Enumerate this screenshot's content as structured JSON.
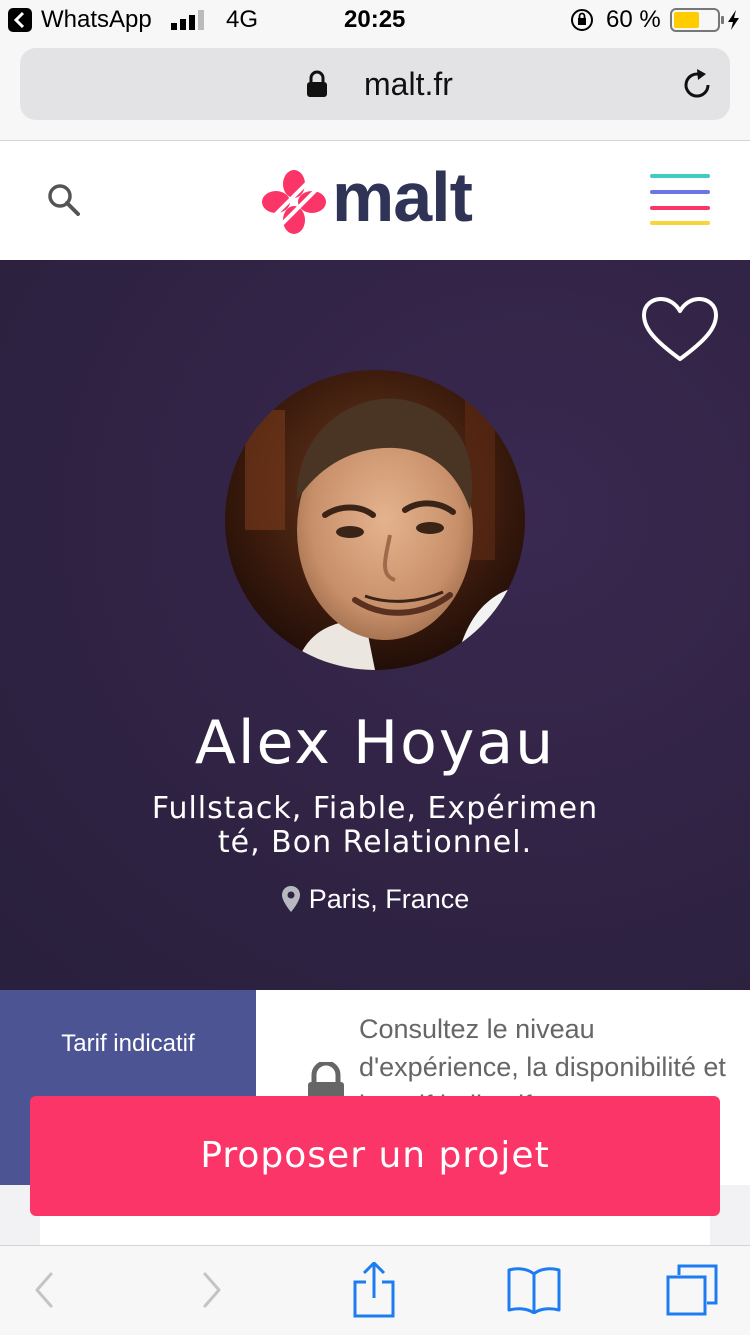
{
  "status_bar": {
    "back_app": "WhatsApp",
    "network": "4G",
    "time": "20:25",
    "battery": "60 %",
    "battery_level": 0.6
  },
  "browser": {
    "url": "malt.fr"
  },
  "site": {
    "logo_text": "malt"
  },
  "profile": {
    "name": "Alex Hoyau",
    "tagline": "Fullstack, Fiable, Expérimenté, Bon Relationnel.",
    "location": "Paris, France"
  },
  "info": {
    "rate_label": "Tarif indicatif",
    "locked_message": "Consultez le niveau d'expérience, la disponibilité et le tarif indicatif"
  },
  "cta": {
    "label": "Proposer un projet"
  },
  "colors": {
    "brand_pink": "#fc3569",
    "brand_navy": "#2f3356",
    "hero_bg": "#302344",
    "rate_panel": "#4c5493",
    "ios_blue": "#1e7cf2"
  }
}
